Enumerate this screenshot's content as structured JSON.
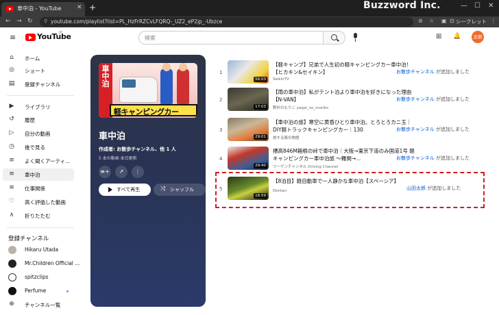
{
  "browser": {
    "tab_title": "車中泊 - YouTube",
    "tab_close": "✕",
    "new_tab": "+",
    "brand": "Buzzword Inc.",
    "url": "youtube.com/playlist?list=PL_HzFrRZCvLFQRQ-_UZ2_eP2jp_-Ubzce",
    "incognito_label": "シークレット",
    "win_min": "—",
    "win_max": "☐",
    "win_close": "✕",
    "back": "←",
    "forward": "→",
    "reload": "↻",
    "lock": "⚲",
    "ab_icons": [
      "⊘",
      "☆",
      "▣",
      "⊡",
      "⋮"
    ]
  },
  "header": {
    "menu_icon": "≡",
    "logo_text": "YouTube",
    "logo_sup": "JP",
    "search_placeholder": "検索",
    "create_icon": "⊞",
    "bell_icon": "🔔",
    "avatar_text": "太郎"
  },
  "sidebar": {
    "items": [
      {
        "icon": "⌂",
        "label": "ホーム"
      },
      {
        "icon": "◎",
        "label": "ショート"
      },
      {
        "icon": "▤",
        "label": "登録チャンネル"
      },
      {
        "icon": "▶",
        "label": "ライブラリ"
      },
      {
        "icon": "↺",
        "label": "履歴"
      },
      {
        "icon": "▷",
        "label": "自分の動画"
      },
      {
        "icon": "◷",
        "label": "後で見る"
      },
      {
        "icon": "≡",
        "label": "よく聞くアーティ..."
      },
      {
        "icon": "≡",
        "label": "車中泊"
      },
      {
        "icon": "≡",
        "label": "仕事関係"
      },
      {
        "icon": "♡",
        "label": "高く評価した動画"
      },
      {
        "icon": "∧",
        "label": "折りたたむ"
      }
    ],
    "subscriptions_heading": "登録チャンネル",
    "channels": [
      {
        "label": "Hikaru Utada"
      },
      {
        "label": "Mr.Children Official ..."
      },
      {
        "label": "spitzclips"
      },
      {
        "label": "Perfume"
      }
    ],
    "browse_channels": {
      "icon": "⊕",
      "label": "チャンネル一覧"
    }
  },
  "playlist": {
    "thumb_red_text": "車中泊",
    "thumb_banner": "軽キャンピングカー",
    "title": "車中泊",
    "author": "作成者: お散歩チャンネル、他 1 人",
    "meta": "5 本の動画  本日更新",
    "add_icon": "≡+",
    "share_icon": "↗",
    "more_icon": "⋮",
    "play_all": "すべて再生",
    "shuffle_icon": "⤨",
    "shuffle": "シャッフル"
  },
  "videos": [
    {
      "index": "1",
      "title": "【軽キャンプ】兄弟で人生初の軽キャンピングカー車中泊！【ヒカキン&セイキン】",
      "channel": "SeikinTV",
      "duration": "56:03",
      "added_by": "お散歩チャンネル",
      "added_suffix": "が追加しました"
    },
    {
      "index": "2",
      "title": "【雨の車中泊】私がテント泊より車中泊を好きになった理由【N-VAN】",
      "channel": "野外のもりこ yagai_no_moriko",
      "duration": "17:03",
      "added_by": "お散歩チャンネル",
      "added_suffix": "が追加しました"
    },
    {
      "index": "3",
      "title": "【車中泊の旅】寒空に黄昏ひとり車中泊。とろとろカニ玉｜DIY軽トラックキャンピングカー｜130",
      "channel": "旅する豚の物語",
      "duration": "29:01",
      "added_by": "お散歩チャンネル",
      "added_suffix": "が追加しました"
    },
    {
      "index": "4",
      "title": "標高846M箱根の峠で車中泊｜大阪→東京下道のみ国道1号 軽キャンピングカー車中泊旅 〜難関→...",
      "channel": "ワーゲンチャンネル Driving Channel",
      "duration": "29:40",
      "added_by": "お散歩チャンネル",
      "added_suffix": "が追加しました"
    },
    {
      "index": "5",
      "title": "【8泊目】軽自動車で一人静かな車中泊【スペーシア】",
      "channel": "Dentan",
      "duration": "16:59",
      "added_by": "山田太郎",
      "added_suffix": "が追加しました"
    }
  ],
  "colors": {
    "accent_red": "#ff0000",
    "link_blue": "#065fd4",
    "highlight": "#d01c1c"
  }
}
